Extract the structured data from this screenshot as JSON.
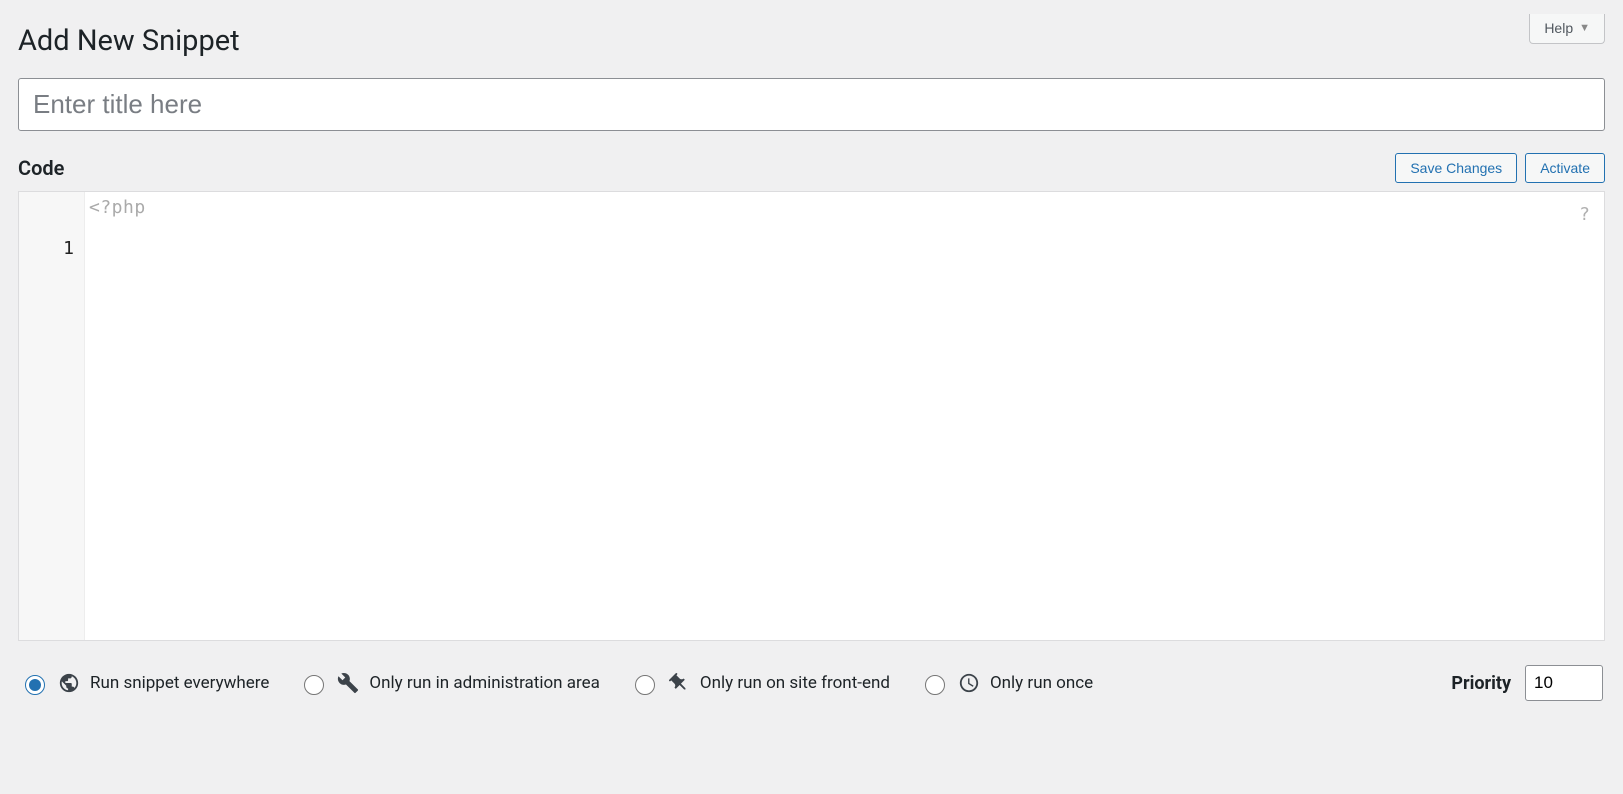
{
  "help": {
    "label": "Help"
  },
  "page": {
    "title": "Add New Snippet"
  },
  "title_input": {
    "placeholder": "Enter title here",
    "value": ""
  },
  "code_section": {
    "heading": "Code"
  },
  "buttons": {
    "save": "Save Changes",
    "activate": "Activate"
  },
  "editor": {
    "php_open_tag": "<?php",
    "line_numbers": [
      "1"
    ],
    "help_indicator": "?"
  },
  "scope": {
    "options": [
      {
        "label": "Run snippet everywhere",
        "checked": true,
        "icon": "globe"
      },
      {
        "label": "Only run in administration area",
        "checked": false,
        "icon": "wrench"
      },
      {
        "label": "Only run on site front-end",
        "checked": false,
        "icon": "pin"
      },
      {
        "label": "Only run once",
        "checked": false,
        "icon": "clock"
      }
    ]
  },
  "priority": {
    "label": "Priority",
    "value": "10"
  }
}
